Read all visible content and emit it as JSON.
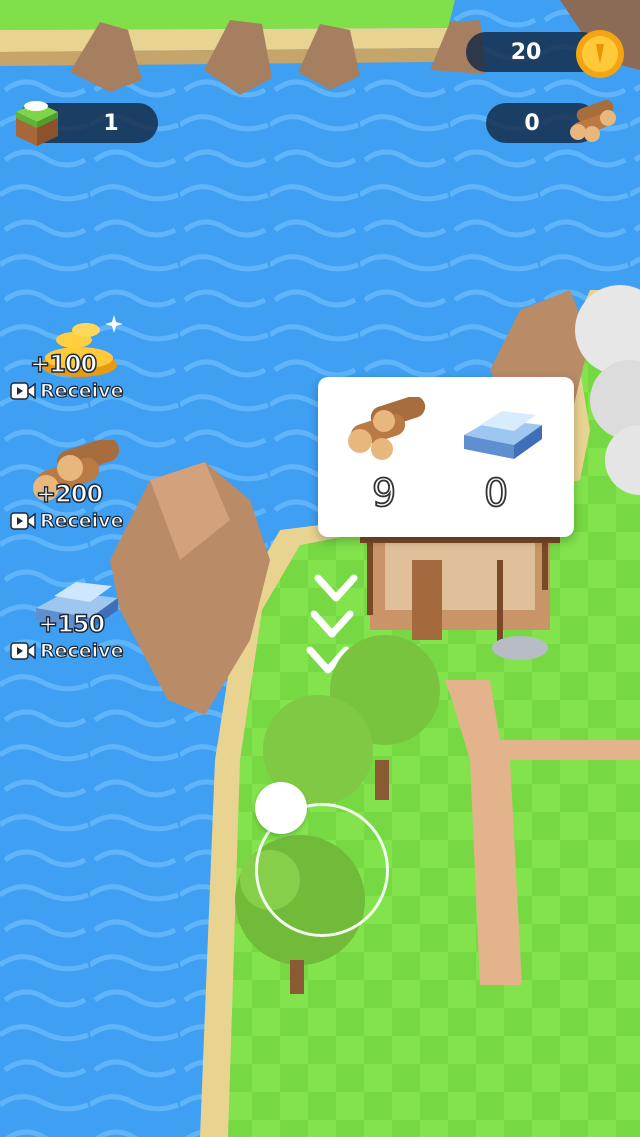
{
  "hud": {
    "coins": "20",
    "wood": "0",
    "tiles": "1"
  },
  "rewards": [
    {
      "amount": "+100",
      "label": "Receive",
      "icon": "gold-coins-icon"
    },
    {
      "amount": "+200",
      "label": "Receive",
      "icon": "wood-logs-icon"
    },
    {
      "amount": "+150",
      "label": "Receive",
      "icon": "iron-ingot-icon"
    }
  ],
  "build_panel": {
    "wood_required": "9",
    "iron_required": "0"
  },
  "colors": {
    "water": "#3f9ff2",
    "grass": "#7fe04a",
    "path": "#e3b48b",
    "rock": "#b98b67"
  }
}
